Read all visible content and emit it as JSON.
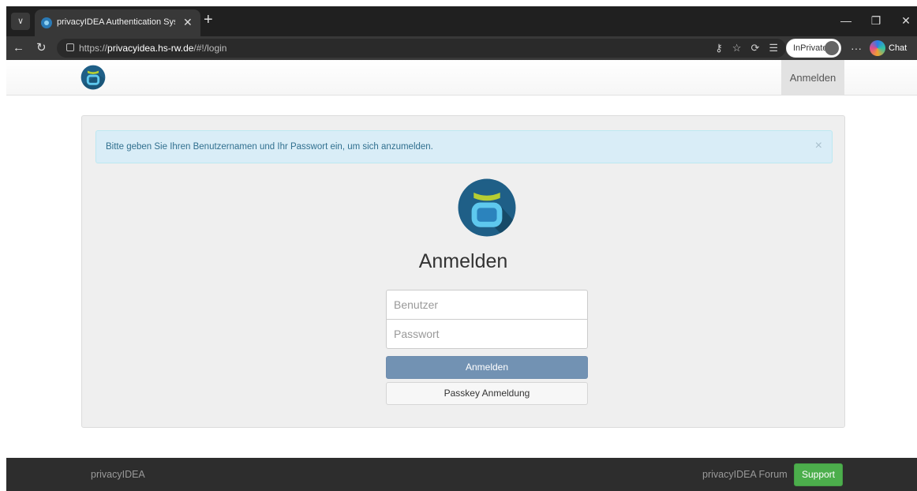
{
  "browser": {
    "tab_title": "privacyIDEA Authentication System",
    "tab_close": "✕",
    "new_tab": "+",
    "url_scheme": "https://",
    "url_host": "privacyidea.hs-rw.de",
    "url_path": "/#!/login",
    "inprivate_label": "InPrivate",
    "more_label": "···",
    "chat_label": "Chat",
    "icons": [
      "tab-list-icon",
      "back-arrow-icon",
      "refresh-icon",
      "lock-icon",
      "key-icon",
      "star-icon",
      "extensions-icon",
      "favorites-icon",
      "minimize-icon",
      "restore-icon",
      "close-icon"
    ]
  },
  "navbar": {
    "login_link": "Anmelden"
  },
  "alert": {
    "message": "Bitte geben Sie Ihren Benutzernamen und Ihr Passwort ein, um sich anzumelden.",
    "close": "×"
  },
  "login": {
    "title": "Anmelden",
    "username_placeholder": "Benutzer",
    "password_placeholder": "Passwort",
    "login_button": "Anmelden",
    "passkey_button": "Passkey Anmeldung"
  },
  "footer": {
    "brand": "privacyIDEA",
    "forum_link": "privacyIDEA Forum",
    "support_button": "Support"
  },
  "colors": {
    "logo_dark": "#1f5f87",
    "logo_blue": "#2b83bd",
    "logo_light": "#5ec8ee",
    "logo_green": "#b6cd32",
    "alert_bg": "#d9edf7",
    "alert_text": "#31708f",
    "login_button": "#7292b3",
    "support_button": "#4cae4c",
    "footer_bg": "#2d2d2d"
  }
}
